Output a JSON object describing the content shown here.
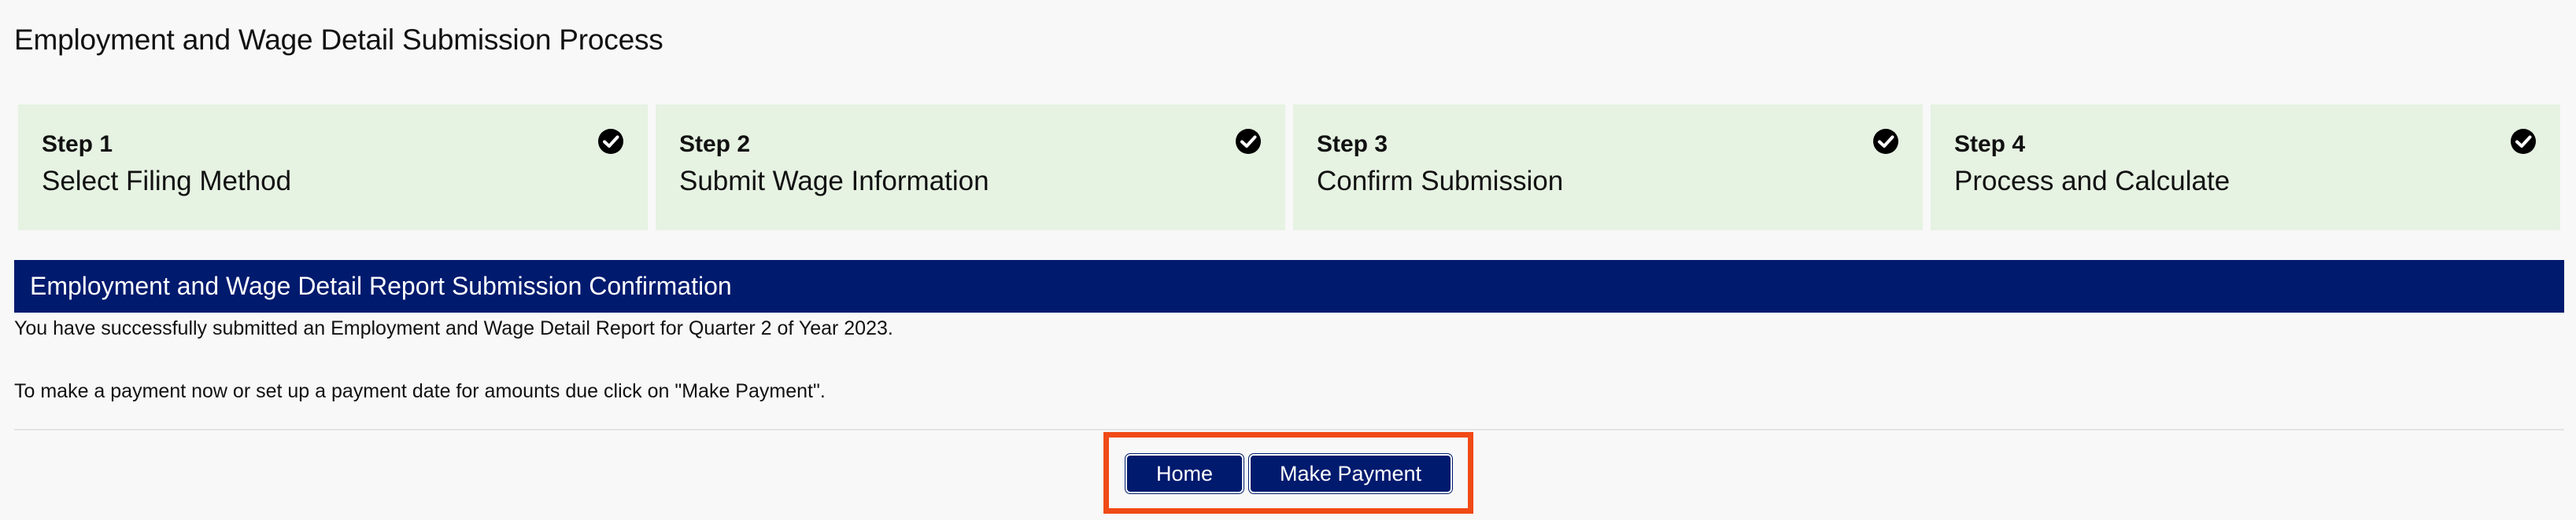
{
  "page": {
    "title": "Employment and Wage Detail Submission Process"
  },
  "steps": [
    {
      "number": "Step 1",
      "label": "Select Filing Method",
      "status_icon": "check-circle-icon"
    },
    {
      "number": "Step 2",
      "label": "Submit Wage Information",
      "status_icon": "check-circle-icon"
    },
    {
      "number": "Step 3",
      "label": "Confirm Submission",
      "status_icon": "check-circle-icon"
    },
    {
      "number": "Step 4",
      "label": "Process and Calculate",
      "status_icon": "check-circle-icon"
    }
  ],
  "confirmation": {
    "banner_title": "Employment and Wage Detail Report Submission Confirmation",
    "success_message": "You have successfully submitted an Employment and Wage Detail Report for Quarter 2 of Year 2023.",
    "payment_message": "To make a payment now or set up a payment date for amounts due click on \"Make Payment\"."
  },
  "actions": {
    "home_label": "Home",
    "make_payment_label": "Make Payment"
  },
  "colors": {
    "banner_bg": "#001a6e",
    "step_bg": "#e6f2e2",
    "button_bg": "#001a6e",
    "highlight_border": "#f04a16"
  }
}
